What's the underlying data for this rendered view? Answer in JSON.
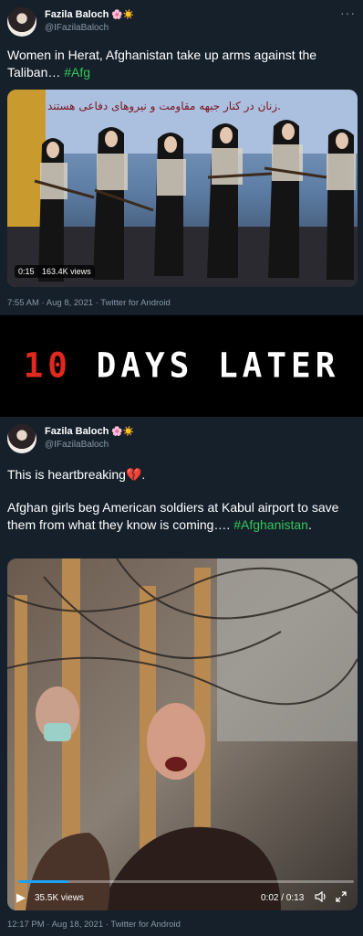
{
  "tweets": [
    {
      "author": "Fazila Baloch",
      "emoji": "🌸☀️",
      "handle": "@IFazilaBaloch",
      "text_main": "Women in Herat, Afghanistan take up arms against the Taliban… ",
      "hashtag": "#Afg",
      "video_time": "0:15",
      "views": "163.4K views",
      "banner_line1": "زنان در کنار جبهه مقاومت و نیروهای دفاعی هستند.",
      "timestamp": "7:55 AM · Aug 8, 2021 · Twitter for Android"
    },
    {
      "author": "Fazila Baloch",
      "emoji": "🌸☀️",
      "handle": "@IFazilaBaloch",
      "text_line1": "This is heartbreaking",
      "heart_emoji": "💔",
      "text_line1_end": ".",
      "text_body": "Afghan girls beg American soldiers at Kabul airport to save them from what they know is coming…. ",
      "hashtag": "#Afghanistan",
      "hashtag_end": ".",
      "views": "35.5K views",
      "time_display": "0:02 / 0:13",
      "progress": 0.15,
      "timestamp": "12:17 PM · Aug 18, 2021 · Twitter for Android"
    }
  ],
  "divider": {
    "number": "10",
    "rest": " DAYS LATER"
  },
  "colors": {
    "background": "#15202b",
    "hashtag": "#34c759",
    "meta": "#8899a6",
    "divider_number": "#e0281e"
  },
  "icons": {
    "more": "more-icon",
    "play": "play-icon",
    "volume": "volume-icon",
    "fullscreen": "fullscreen-icon"
  }
}
